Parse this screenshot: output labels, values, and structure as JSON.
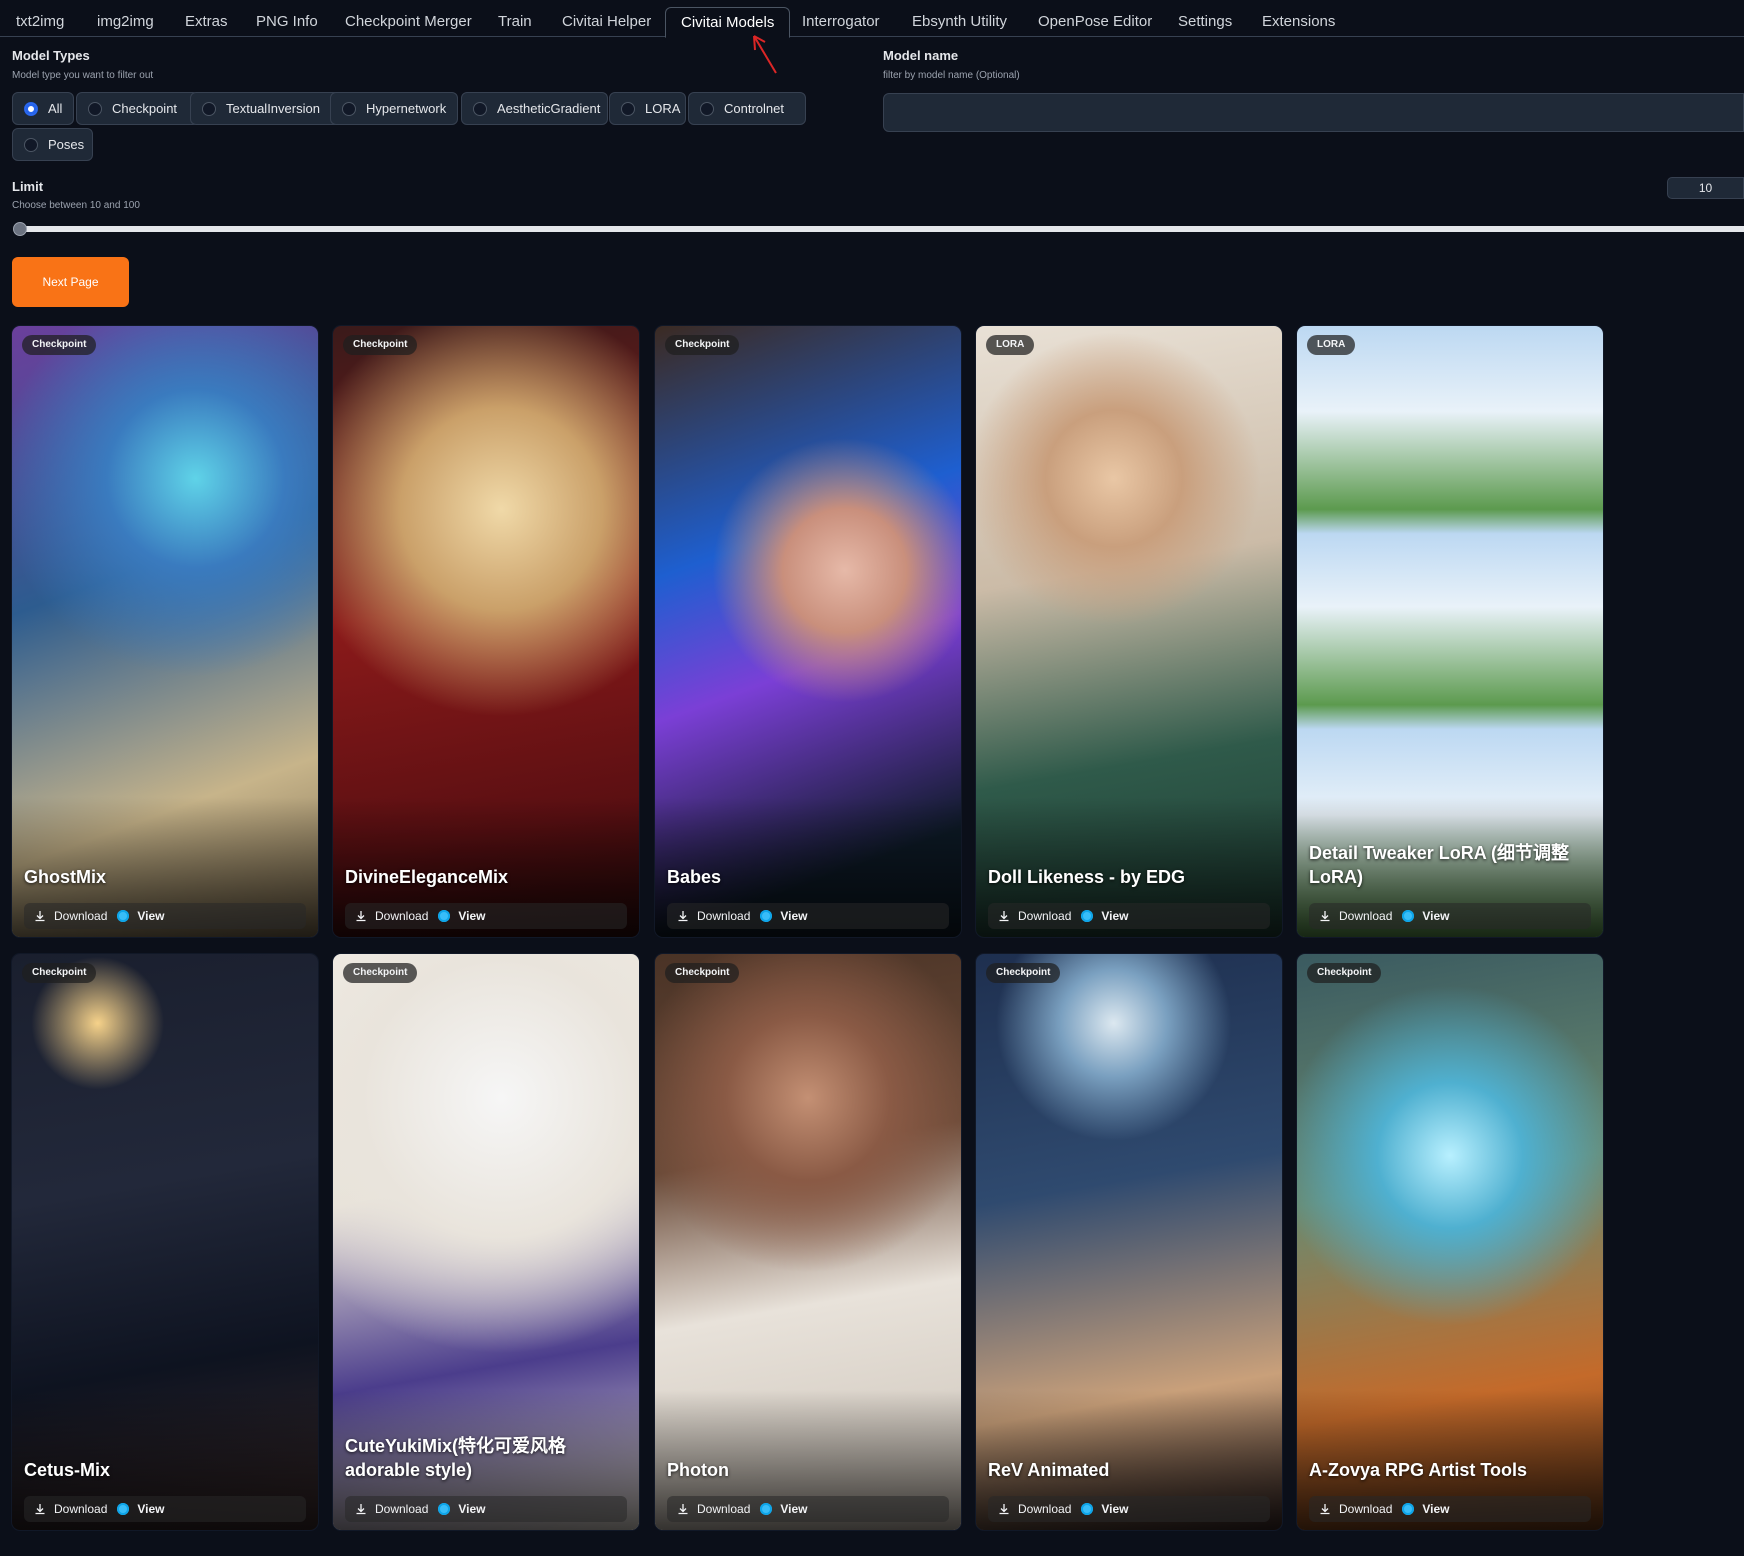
{
  "tabs": [
    {
      "label": "txt2img",
      "active": false
    },
    {
      "label": "img2img",
      "active": false
    },
    {
      "label": "Extras",
      "active": false
    },
    {
      "label": "PNG Info",
      "active": false
    },
    {
      "label": "Checkpoint Merger",
      "active": false
    },
    {
      "label": "Train",
      "active": false
    },
    {
      "label": "Civitai Helper",
      "active": false
    },
    {
      "label": "Civitai Models",
      "active": true
    },
    {
      "label": "Interrogator",
      "active": false
    },
    {
      "label": "Ebsynth Utility",
      "active": false
    },
    {
      "label": "OpenPose Editor",
      "active": false
    },
    {
      "label": "Settings",
      "active": false
    },
    {
      "label": "Extensions",
      "active": false
    }
  ],
  "filters": {
    "model_types_label": "Model Types",
    "model_types_hint": "Model type you want to filter out",
    "model_types": [
      {
        "label": "All",
        "selected": true
      },
      {
        "label": "Checkpoint",
        "selected": false
      },
      {
        "label": "TextualInversion",
        "selected": false
      },
      {
        "label": "Hypernetwork",
        "selected": false
      },
      {
        "label": "AestheticGradient",
        "selected": false
      },
      {
        "label": "LORA",
        "selected": false
      },
      {
        "label": "Controlnet",
        "selected": false
      },
      {
        "label": "Poses",
        "selected": false
      }
    ],
    "model_name_label": "Model name",
    "model_name_hint": "filter by model name (Optional)",
    "model_name_value": "",
    "limit_label": "Limit",
    "limit_hint": "Choose between 10 and 100",
    "limit_value": "10",
    "limit_min": 10,
    "limit_max": 100
  },
  "next_page_label": "Next Page",
  "card_actions": {
    "download": "Download",
    "view": "View"
  },
  "cards": [
    {
      "badge": "Checkpoint",
      "title": "GhostMix"
    },
    {
      "badge": "Checkpoint",
      "title": "DivineEleganceMix"
    },
    {
      "badge": "Checkpoint",
      "title": "Babes"
    },
    {
      "badge": "LORA",
      "title": "Doll Likeness - by EDG"
    },
    {
      "badge": "LORA",
      "title": "Detail Tweaker LoRA (细节调整LoRA)"
    },
    {
      "badge": "Checkpoint",
      "title": "Cetus-Mix"
    },
    {
      "badge": "Checkpoint",
      "title": "CuteYukiMix(特化可爱风格adorable style)"
    },
    {
      "badge": "Checkpoint",
      "title": "Photon"
    },
    {
      "badge": "Checkpoint",
      "title": "ReV Animated"
    },
    {
      "badge": "Checkpoint",
      "title": "A-Zovya RPG Artist Tools"
    }
  ],
  "colors": {
    "accent": "#f97316",
    "selected_radio": "#2563eb",
    "background": "#0b0f19"
  }
}
